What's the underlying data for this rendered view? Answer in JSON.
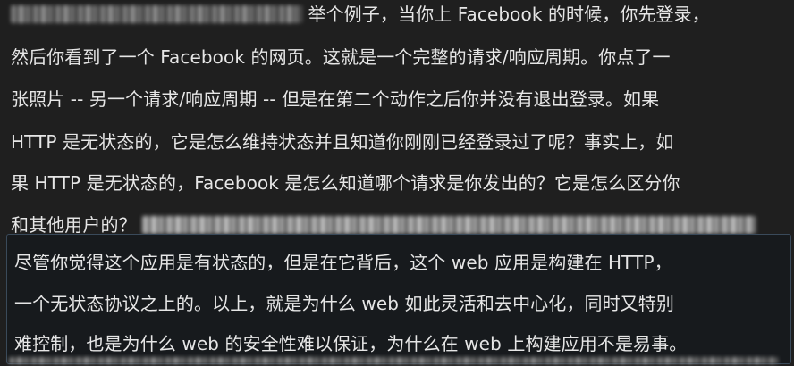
{
  "paragraph1": {
    "line1_text": "举个例子，当你上 Facebook 的时候，你先登录，",
    "line2": "然后你看到了一个 Facebook 的网页。这就是一个完整的请求/响应周期。你点了一",
    "line3": "张照片 -- 另一个请求/响应周期 -- 但是在第二个动作之后你并没有退出登录。如果",
    "line4": "HTTP 是无状态的，它是怎么维持状态并且知道你刚刚已经登录过了呢？事实上，如",
    "line5": "果 HTTP 是无状态的，Facebook 是怎么知道哪个请求是你发出的？它是怎么区分你",
    "line6_text": "和其他用户的？"
  },
  "quote": {
    "line1": "尽管你觉得这个应用是有状态的，但是在它背后，这个 web 应用是构建在 HTTP，",
    "line2": "一个无状态协议之上的。以上，就是为什么 web 如此灵活和去中心化，同时又特别",
    "line3": "难控制，也是为什么 web 的安全性难以保证，为什么在 web 上构建应用不是易事。"
  },
  "colors": {
    "background": "#1f1f1f",
    "text": "#e6e6e6",
    "quote_background": "#171a1d",
    "quote_border": "#3a4a5a"
  }
}
